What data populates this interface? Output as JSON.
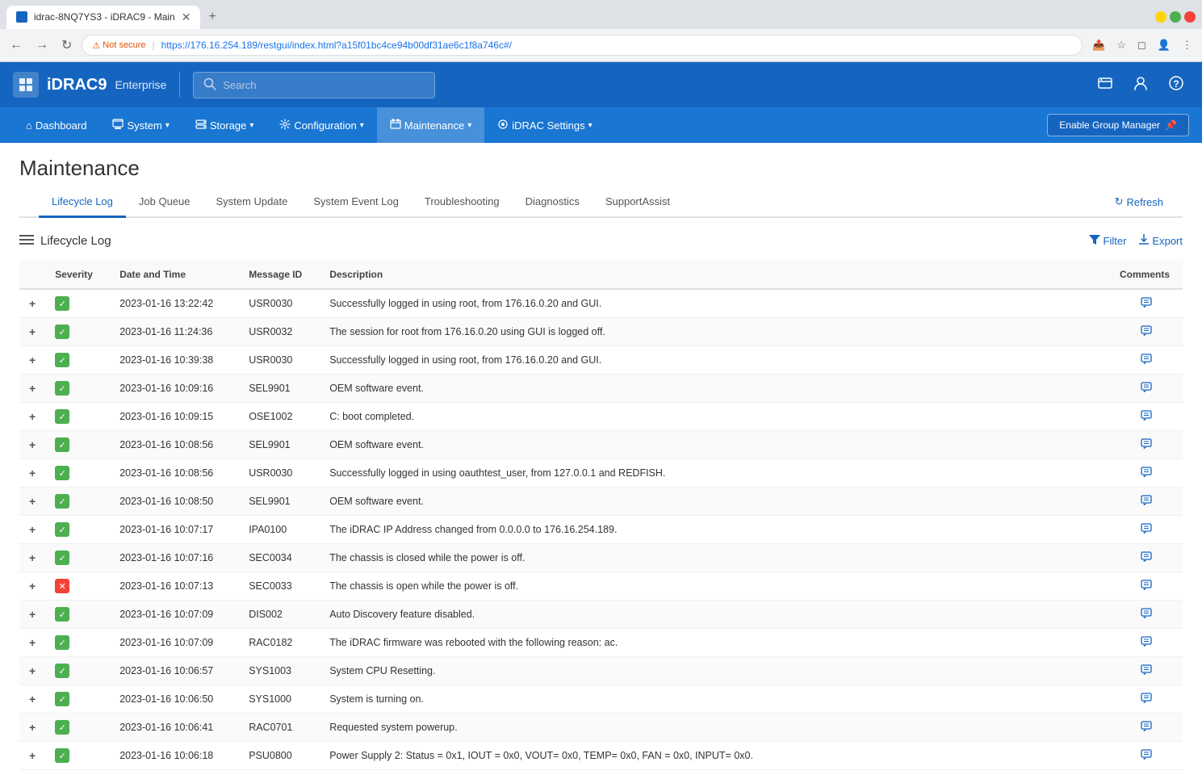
{
  "browser": {
    "tab_title": "idrac-8NQ7YS3 - iDRAC9 - Main",
    "url": "https://176.16.254.189/restgui/index.html?a15f01bc4ce94b00df31ae6c1f8a746c#/",
    "not_secure_label": "Not secure"
  },
  "header": {
    "logo_text": "iDRAC9",
    "enterprise_text": "Enterprise",
    "search_placeholder": "Search"
  },
  "nav": {
    "items": [
      {
        "id": "dashboard",
        "label": "Dashboard",
        "icon": "⌂",
        "has_chevron": false
      },
      {
        "id": "system",
        "label": "System",
        "icon": "≡",
        "has_chevron": true
      },
      {
        "id": "storage",
        "label": "Storage",
        "icon": "▦",
        "has_chevron": true
      },
      {
        "id": "configuration",
        "label": "Configuration",
        "icon": "⚙",
        "has_chevron": true
      },
      {
        "id": "maintenance",
        "label": "Maintenance",
        "icon": "✉",
        "has_chevron": true,
        "active": true
      },
      {
        "id": "idrac_settings",
        "label": "iDRAC Settings",
        "icon": "◎",
        "has_chevron": true
      }
    ],
    "enable_group_btn": "Enable Group Manager"
  },
  "page": {
    "title": "Maintenance",
    "tabs": [
      {
        "id": "lifecycle_log",
        "label": "Lifecycle Log",
        "active": true
      },
      {
        "id": "job_queue",
        "label": "Job Queue",
        "active": false
      },
      {
        "id": "system_update",
        "label": "System Update",
        "active": false
      },
      {
        "id": "system_event_log",
        "label": "System Event Log",
        "active": false
      },
      {
        "id": "troubleshooting",
        "label": "Troubleshooting",
        "active": false
      },
      {
        "id": "diagnostics",
        "label": "Diagnostics",
        "active": false
      },
      {
        "id": "supportassist",
        "label": "SupportAssist",
        "active": false
      }
    ],
    "refresh_btn": "Refresh"
  },
  "lifecycle_log": {
    "section_title": "Lifecycle Log",
    "filter_btn": "Filter",
    "export_btn": "Export",
    "columns": [
      "Severity",
      "Date and Time",
      "Message ID",
      "Description",
      "Comments"
    ],
    "rows": [
      {
        "severity": "ok",
        "datetime": "2023-01-16 13:22:42",
        "msg_id": "USR0030",
        "description": "Successfully logged in using root, from 176.16.0.20 and GUI.",
        "has_comment": true
      },
      {
        "severity": "ok",
        "datetime": "2023-01-16 11:24:36",
        "msg_id": "USR0032",
        "description": "The session for root from 176.16.0.20 using GUI is logged off.",
        "has_comment": true
      },
      {
        "severity": "ok",
        "datetime": "2023-01-16 10:39:38",
        "msg_id": "USR0030",
        "description": "Successfully logged in using root, from 176.16.0.20 and GUI.",
        "has_comment": true
      },
      {
        "severity": "ok",
        "datetime": "2023-01-16 10:09:16",
        "msg_id": "SEL9901",
        "description": "OEM software event.",
        "has_comment": true
      },
      {
        "severity": "ok",
        "datetime": "2023-01-16 10:09:15",
        "msg_id": "OSE1002",
        "description": "C: boot completed.",
        "has_comment": true
      },
      {
        "severity": "ok",
        "datetime": "2023-01-16 10:08:56",
        "msg_id": "SEL9901",
        "description": "OEM software event.",
        "has_comment": true
      },
      {
        "severity": "ok",
        "datetime": "2023-01-16 10:08:56",
        "msg_id": "USR0030",
        "description": "Successfully logged in using oauthtest_user, from 127.0.0.1 and REDFISH.",
        "has_comment": true
      },
      {
        "severity": "ok",
        "datetime": "2023-01-16 10:08:50",
        "msg_id": "SEL9901",
        "description": "OEM software event.",
        "has_comment": true
      },
      {
        "severity": "ok",
        "datetime": "2023-01-16 10:07:17",
        "msg_id": "IPA0100",
        "description": "The iDRAC IP Address changed from 0.0.0.0 to 176.16.254.189.",
        "has_comment": true
      },
      {
        "severity": "ok",
        "datetime": "2023-01-16 10:07:16",
        "msg_id": "SEC0034",
        "description": "The chassis is closed while the power is off.",
        "has_comment": true
      },
      {
        "severity": "error",
        "datetime": "2023-01-16 10:07:13",
        "msg_id": "SEC0033",
        "description": "The chassis is open while the power is off.",
        "has_comment": true
      },
      {
        "severity": "ok",
        "datetime": "2023-01-16 10:07:09",
        "msg_id": "DIS002",
        "description": "Auto Discovery feature disabled.",
        "has_comment": true
      },
      {
        "severity": "ok",
        "datetime": "2023-01-16 10:07:09",
        "msg_id": "RAC0182",
        "description": "The iDRAC firmware was rebooted with the following reason: ac.",
        "has_comment": true
      },
      {
        "severity": "ok",
        "datetime": "2023-01-16 10:06:57",
        "msg_id": "SYS1003",
        "description": "System CPU Resetting.",
        "has_comment": true
      },
      {
        "severity": "ok",
        "datetime": "2023-01-16 10:06:50",
        "msg_id": "SYS1000",
        "description": "System is turning on.",
        "has_comment": true
      },
      {
        "severity": "ok",
        "datetime": "2023-01-16 10:06:41",
        "msg_id": "RAC0701",
        "description": "Requested system powerup.",
        "has_comment": true
      },
      {
        "severity": "ok",
        "datetime": "2023-01-16 10:06:18",
        "msg_id": "PSU0800",
        "description": "Power Supply 2: Status = 0x1, IOUT = 0x0, VOUT= 0x0, TEMP= 0x0, FAN = 0x0, INPUT= 0x0.",
        "has_comment": true
      }
    ]
  }
}
